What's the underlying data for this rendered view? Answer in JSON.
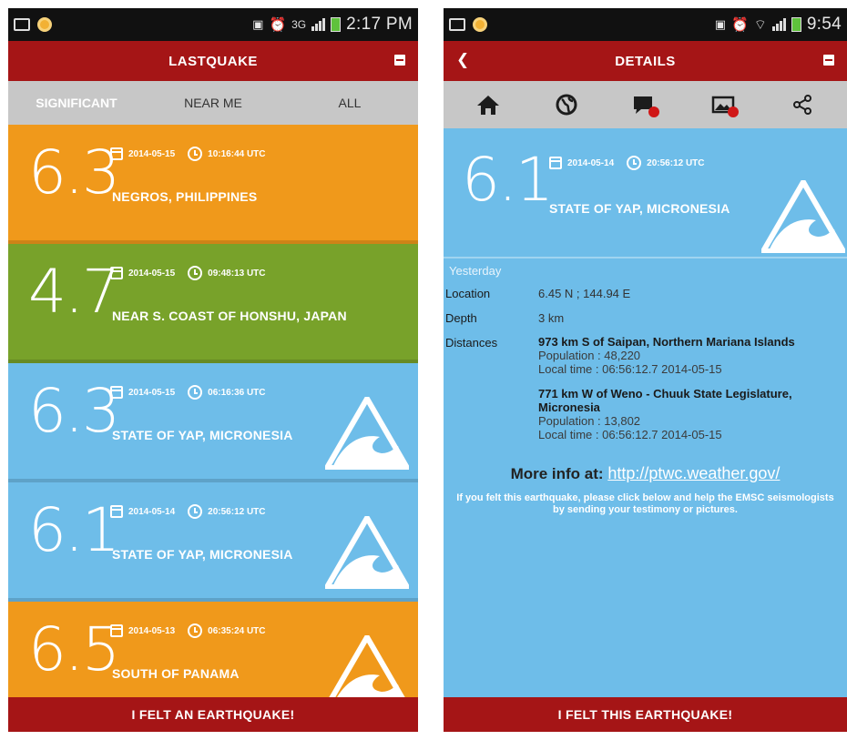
{
  "left": {
    "status": {
      "signal": "3G",
      "time": "2:17 PM"
    },
    "title": "LASTQUAKE",
    "tabs": [
      "SIGNIFICANT",
      "NEAR ME",
      "ALL"
    ],
    "quakes": [
      {
        "mag": "6.3",
        "date": "2014-05-15",
        "time": "10:16:44 UTC",
        "region": "NEGROS, PHILIPPINES",
        "color": "#f0991b"
      },
      {
        "mag": "4.7",
        "date": "2014-05-15",
        "time": "09:48:13 UTC",
        "region": "NEAR S. COAST OF HONSHU, JAPAN",
        "color": "#78a22a"
      },
      {
        "mag": "6.3",
        "date": "2014-05-15",
        "time": "06:16:36 UTC",
        "region": "STATE OF YAP, MICRONESIA",
        "color": "#6ebde9"
      },
      {
        "mag": "6.1",
        "date": "2014-05-14",
        "time": "20:56:12 UTC",
        "region": "STATE OF YAP, MICRONESIA",
        "color": "#6ebde9"
      },
      {
        "mag": "6.5",
        "date": "2014-05-13",
        "time": "06:35:24 UTC",
        "region": "SOUTH OF PANAMA",
        "color": "#f0991b"
      }
    ],
    "bottom_button": "I FELT AN EARTHQUAKE!"
  },
  "right": {
    "status": {
      "time": "9:54"
    },
    "title": "DETAILS",
    "tools": [
      "home-icon",
      "globe-icon",
      "comments-icon",
      "pictures-icon",
      "share-icon"
    ],
    "header": {
      "mag": "6.1",
      "date": "2014-05-14",
      "time": "20:56:12 UTC",
      "region": "STATE OF YAP, MICRONESIA"
    },
    "yesterday": "Yesterday",
    "location_label": "Location",
    "location_value": "6.45 N ; 144.94 E",
    "depth_label": "Depth",
    "depth_value": "3 km",
    "distances_label": "Distances",
    "distances": [
      {
        "title": "973 km S of Saipan, Northern Mariana Islands",
        "population": "Population : 48,220",
        "local_time": "Local time : 06:56:12.7 2014-05-15"
      },
      {
        "title": "771 km W of Weno - Chuuk State Legislature, Micronesia",
        "population": "Population : 13,802",
        "local_time": "Local time : 06:56:12.7 2014-05-15"
      }
    ],
    "more_info_label": "More info at:",
    "more_info_link": "http://ptwc.weather.gov/",
    "help_text": "If you felt this earthquake, please click below and help the EMSC seismologists by sending your testimony or pictures.",
    "bottom_button": "I FELT THIS EARTHQUAKE!"
  }
}
